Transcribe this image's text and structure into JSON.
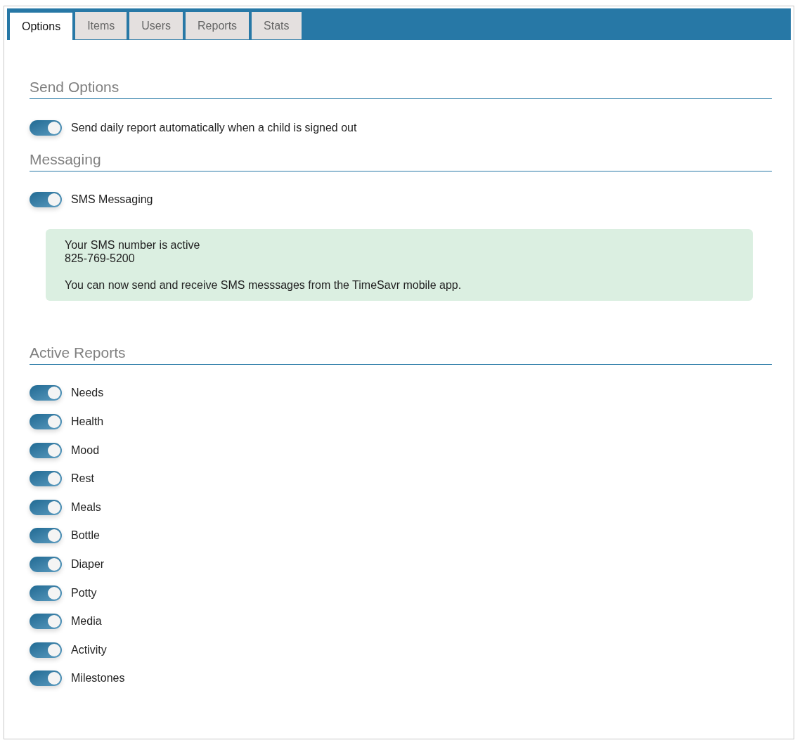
{
  "tabs": [
    {
      "label": "Options",
      "selected": true
    },
    {
      "label": "Items",
      "selected": false
    },
    {
      "label": "Users",
      "selected": false
    },
    {
      "label": "Reports",
      "selected": false
    },
    {
      "label": "Stats",
      "selected": false
    }
  ],
  "send_options": {
    "heading": "Send Options",
    "toggles": [
      {
        "label": "Send daily report automatically when a child is signed out",
        "on": true
      }
    ]
  },
  "messaging": {
    "heading": "Messaging",
    "toggles": [
      {
        "label": "SMS Messaging",
        "on": true
      }
    ],
    "notice": {
      "status": "Your SMS number is active",
      "number": "825-769-5200",
      "message": "You can now send and receive SMS messsages from the TimeSavr mobile app."
    }
  },
  "active_reports": {
    "heading": "Active Reports",
    "toggles": [
      {
        "label": "Needs",
        "on": true
      },
      {
        "label": "Health",
        "on": true
      },
      {
        "label": "Mood",
        "on": true
      },
      {
        "label": "Rest",
        "on": true
      },
      {
        "label": "Meals",
        "on": true
      },
      {
        "label": "Bottle",
        "on": true
      },
      {
        "label": "Diaper",
        "on": true
      },
      {
        "label": "Potty",
        "on": true
      },
      {
        "label": "Media",
        "on": true
      },
      {
        "label": "Activity",
        "on": true
      },
      {
        "label": "Milestones",
        "on": true
      }
    ]
  }
}
